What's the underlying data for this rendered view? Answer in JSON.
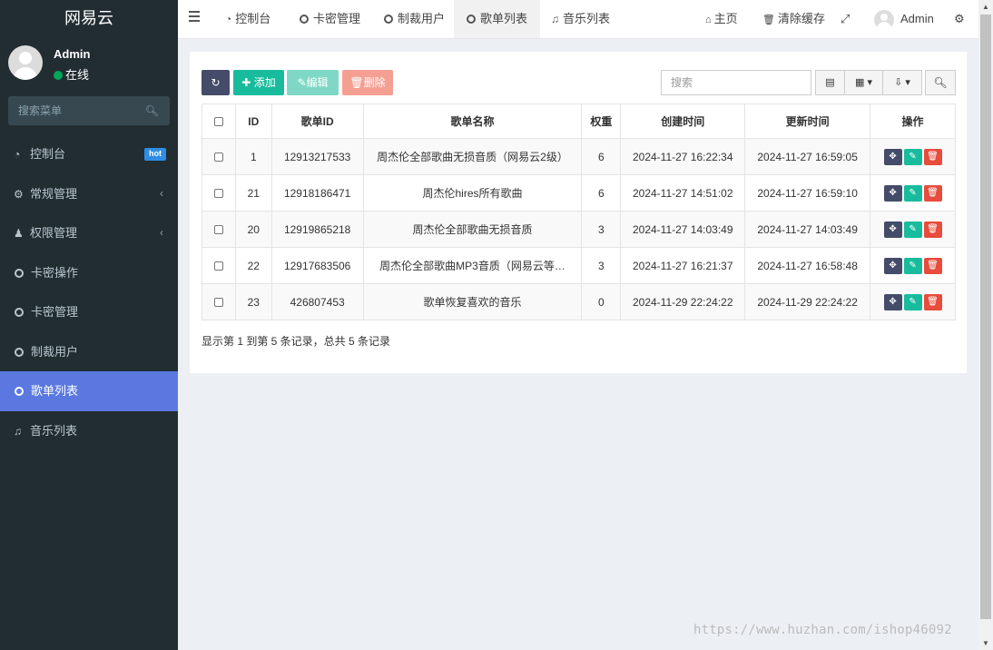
{
  "app": {
    "brand": "网易云"
  },
  "user": {
    "name": "Admin",
    "status": "在线"
  },
  "sidebar": {
    "search_placeholder": "搜索菜单",
    "items": [
      {
        "label": "控制台",
        "icon": "dashboard-icon",
        "badge": "hot"
      },
      {
        "label": "常规管理",
        "icon": "cogs-icon",
        "chevron": "‹"
      },
      {
        "label": "权限管理",
        "icon": "users-icon",
        "chevron": "‹"
      },
      {
        "label": "卡密操作",
        "icon": "circle-icon"
      },
      {
        "label": "卡密管理",
        "icon": "circle-icon"
      },
      {
        "label": "制裁用户",
        "icon": "circle-icon"
      },
      {
        "label": "歌单列表",
        "icon": "circle-icon",
        "active": true
      },
      {
        "label": "音乐列表",
        "icon": "music-icon"
      }
    ]
  },
  "topbar": {
    "tabs": [
      {
        "label": "控制台",
        "icon": "dashboard-icon"
      },
      {
        "label": "卡密管理",
        "icon": "circle-icon"
      },
      {
        "label": "制裁用户",
        "icon": "circle-icon"
      },
      {
        "label": "歌单列表",
        "icon": "circle-icon",
        "active": true
      },
      {
        "label": "音乐列表",
        "icon": "music-icon"
      }
    ],
    "home_label": "主页",
    "clear_cache_label": "清除缓存",
    "user_name": "Admin"
  },
  "toolbar": {
    "add_label": "添加",
    "edit_label": "编辑",
    "delete_label": "删除",
    "search_placeholder": "搜索"
  },
  "table": {
    "columns": [
      "ID",
      "歌单ID",
      "歌单名称",
      "权重",
      "创建时间",
      "更新时间",
      "操作"
    ],
    "rows": [
      {
        "id": "1",
        "playlist_id": "12913217533",
        "name": "周杰伦全部歌曲无损音质（网易云2级）",
        "weight": "6",
        "created": "2024-11-27 16:22:34",
        "updated": "2024-11-27 16:59:05"
      },
      {
        "id": "21",
        "playlist_id": "12918186471",
        "name": "周杰伦hires所有歌曲",
        "weight": "6",
        "created": "2024-11-27 14:51:02",
        "updated": "2024-11-27 16:59:10"
      },
      {
        "id": "20",
        "playlist_id": "12919865218",
        "name": "周杰伦全部歌曲无损音质",
        "weight": "3",
        "created": "2024-11-27 14:03:49",
        "updated": "2024-11-27 14:03:49"
      },
      {
        "id": "22",
        "playlist_id": "12917683506",
        "name": "周杰伦全部歌曲MP3音质（网易云等…",
        "weight": "3",
        "created": "2024-11-27 16:21:37",
        "updated": "2024-11-27 16:58:48"
      },
      {
        "id": "23",
        "playlist_id": "426807453",
        "name": "歌单恢复喜欢的音乐",
        "weight": "0",
        "created": "2024-11-29 22:24:22",
        "updated": "2024-11-29 22:24:22"
      }
    ]
  },
  "pagination": {
    "summary": "显示第 1 到第 5 条记录，总共 5 条记录"
  },
  "watermark": "https://www.huzhan.com/ishop46092"
}
